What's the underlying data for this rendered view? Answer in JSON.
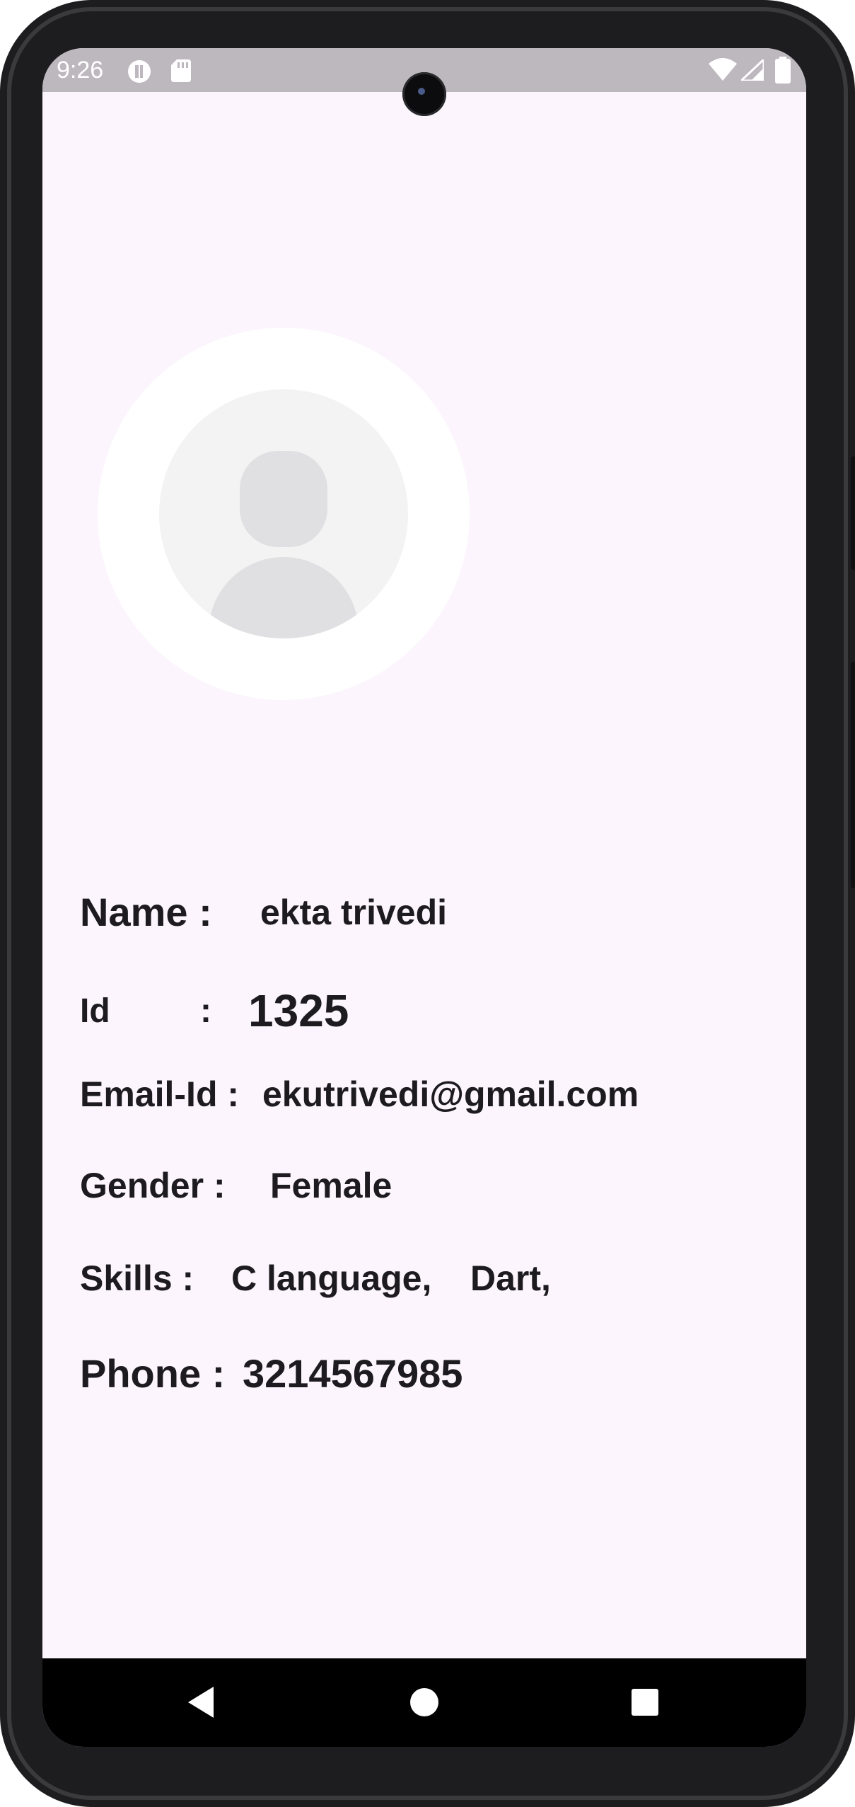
{
  "status_bar": {
    "time": "9:26",
    "icons": [
      "cast-icon",
      "sd-card-icon",
      "wifi-icon",
      "signal-icon",
      "battery-icon"
    ]
  },
  "profile": {
    "avatar_icon": "default-avatar-icon",
    "name_label": "Name  :",
    "name_value": "ekta trivedi",
    "id_label": "Id",
    "id_colon": ":",
    "id_value": "1325",
    "email_label": "Email-Id :",
    "email_value": "ekutrivedi@gmail.com",
    "gender_label": "Gender :",
    "gender_value": "Female",
    "skills_label": "Skills :",
    "skills": [
      "C language,",
      "Dart,"
    ],
    "phone_label": "Phone  :",
    "phone_value": "3214567985"
  },
  "nav_bar": {
    "buttons": [
      "back-icon",
      "home-icon",
      "recents-icon"
    ]
  },
  "colors": {
    "background": "#fcf5fd",
    "status_bar": "#bdb8be",
    "text": "#1d1b20",
    "avatar_placeholder": "#e0e0e2"
  }
}
